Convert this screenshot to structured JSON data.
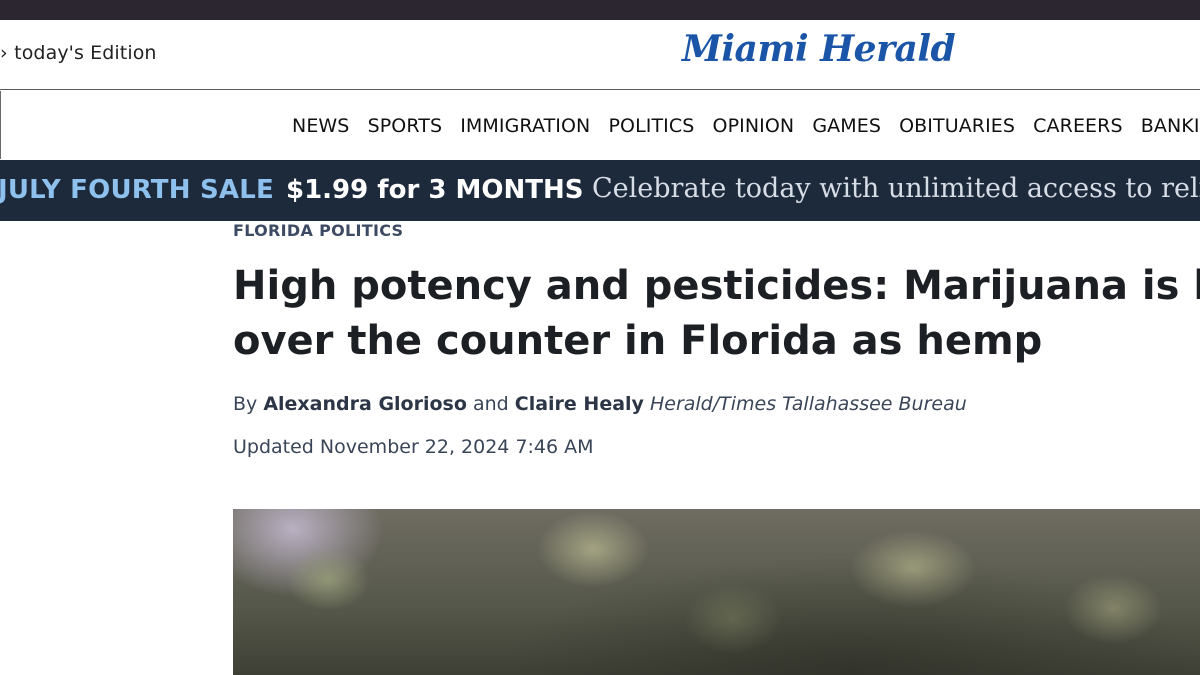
{
  "masthead": {
    "edition_link": "today's Edition",
    "logo_text": "Miami Herald",
    "logo_color": "#1b55a8"
  },
  "nav": {
    "items": [
      "NEWS",
      "SPORTS",
      "IMMIGRATION",
      "POLITICS",
      "OPINION",
      "GAMES",
      "OBITUARIES",
      "CAREERS",
      "BANKING"
    ]
  },
  "promo": {
    "sale_label": "JULY FOURTH SALE",
    "price_label": "$1.99 for 3 MONTHS",
    "tagline": "Celebrate today with unlimited access to reliable",
    "background_color": "#1d2a3b",
    "accent_color": "#8fc1ee"
  },
  "article": {
    "kicker": "FLORIDA POLITICS",
    "headline_line1": "High potency and pesticides: Marijuana is being sold",
    "headline_line2": "over the counter in Florida as hemp",
    "byline_prefix": "By",
    "author1": "Alexandra Glorioso",
    "byline_and": "and",
    "author2": "Claire Healy",
    "bureau": "Herald/Times Tallahassee Bureau",
    "updated": "Updated November 22, 2024 7:46 AM"
  }
}
